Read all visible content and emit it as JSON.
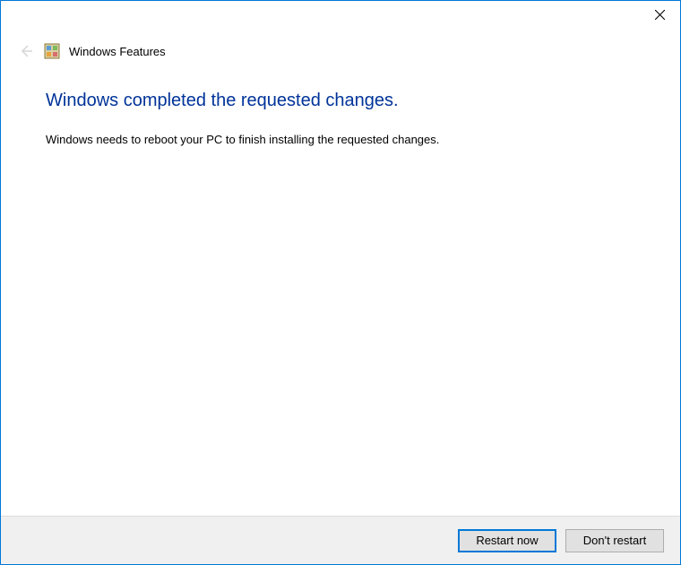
{
  "titlebar": {
    "close_icon": "close-icon"
  },
  "header": {
    "back_icon": "back-arrow-icon",
    "app_icon": "windows-features-icon",
    "title": "Windows Features"
  },
  "main": {
    "heading": "Windows completed the requested changes.",
    "body": "Windows needs to reboot your PC to finish installing the requested changes."
  },
  "footer": {
    "restart_label": "Restart now",
    "dont_restart_label": "Don't restart"
  }
}
